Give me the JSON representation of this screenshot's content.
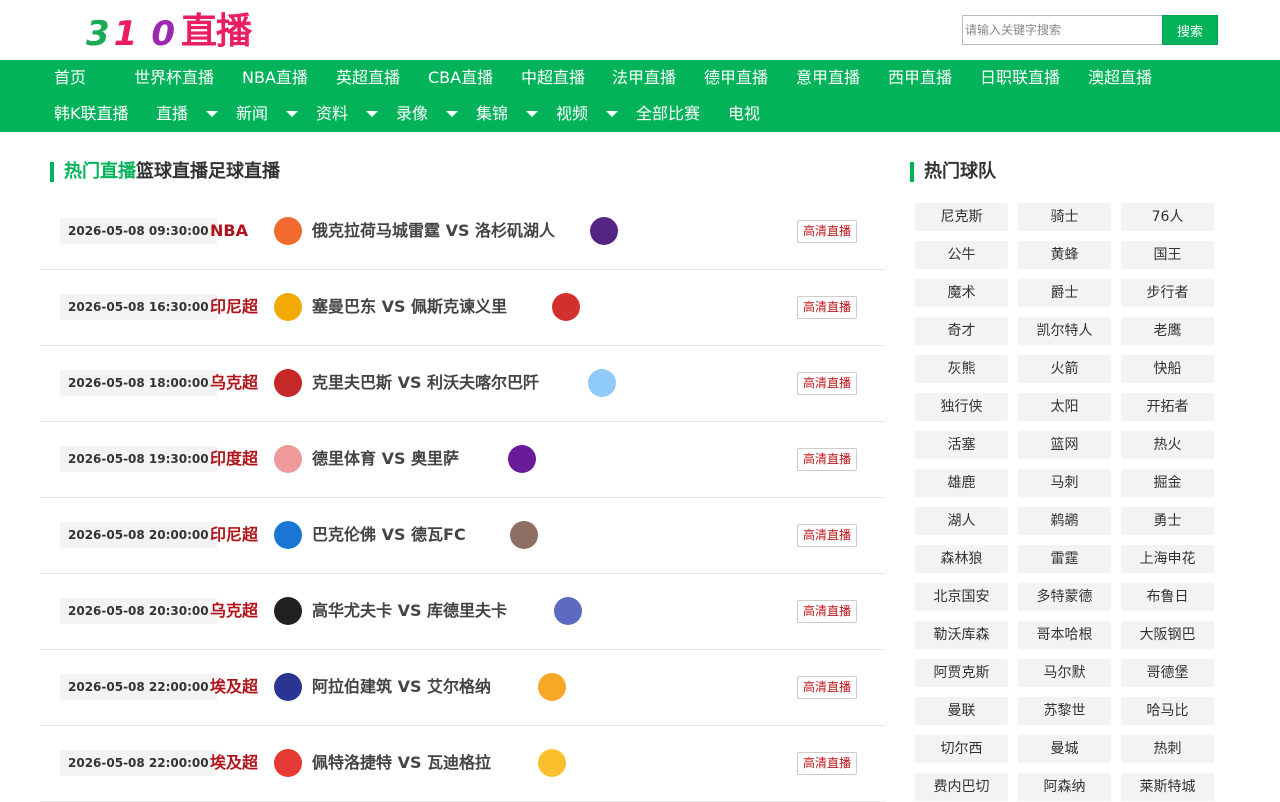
{
  "logo": {
    "d1": "3",
    "d2": "1",
    "d3": "0",
    "zh": "直播"
  },
  "search": {
    "placeholder": "请输入关键字搜索",
    "button": "搜索"
  },
  "nav": {
    "row1": [
      "首页",
      "世界杯直播",
      "NBA直播",
      "英超直播",
      "CBA直播",
      "中超直播",
      "法甲直播",
      "德甲直播",
      "意甲直播",
      "西甲直播",
      "日职联直播",
      "澳超直播"
    ],
    "row2": [
      "韩K联直播",
      "直播",
      "新闻",
      "资料",
      "录像",
      "集锦",
      "视频",
      "全部比赛",
      "电视"
    ]
  },
  "section": {
    "tabs": [
      "热门直播",
      "篮球直播",
      "足球直播"
    ]
  },
  "hd_label": "高清直播",
  "matches": [
    {
      "time": "2026-05-08 09:30:00",
      "league": "NBA",
      "teams": "俄克拉荷马城雷霆 VS 洛杉矶湖人",
      "color_a": "#f26a2e",
      "color_b": "#552583"
    },
    {
      "time": "2026-05-08 16:30:00",
      "league": "印尼超",
      "teams": "塞曼巴东 VS 佩斯克谏义里",
      "color_a": "#f2a900",
      "color_b": "#d32f2f"
    },
    {
      "time": "2026-05-08 18:00:00",
      "league": "乌克超",
      "teams": "克里夫巴斯 VS 利沃夫喀尔巴阡",
      "color_a": "#c62828",
      "color_b": "#90caf9"
    },
    {
      "time": "2026-05-08 19:30:00",
      "league": "印度超",
      "teams": "德里体育 VS 奥里萨",
      "color_a": "#ef9a9a",
      "color_b": "#6a1b9a"
    },
    {
      "time": "2026-05-08 20:00:00",
      "league": "印尼超",
      "teams": "巴克伦佛 VS 德瓦FC",
      "color_a": "#1976d2",
      "color_b": "#8d6e63"
    },
    {
      "time": "2026-05-08 20:30:00",
      "league": "乌克超",
      "teams": "高华尤夫卡 VS 库德里夫卡",
      "color_a": "#212121",
      "color_b": "#5c6bc0"
    },
    {
      "time": "2026-05-08 22:00:00",
      "league": "埃及超",
      "teams": "阿拉伯建筑 VS 艾尔格纳",
      "color_a": "#283593",
      "color_b": "#f9a825"
    },
    {
      "time": "2026-05-08 22:00:00",
      "league": "埃及超",
      "teams": "佩特洛捷特 VS 瓦迪格拉",
      "color_a": "#e53935",
      "color_b": "#fbc02d"
    }
  ],
  "sidebar": {
    "title": "热门球队",
    "teams": [
      "尼克斯",
      "骑士",
      "76人",
      "公牛",
      "黄蜂",
      "国王",
      "魔术",
      "爵士",
      "步行者",
      "奇才",
      "凯尔特人",
      "老鹰",
      "灰熊",
      "火箭",
      "快船",
      "独行侠",
      "太阳",
      "开拓者",
      "活塞",
      "篮网",
      "热火",
      "雄鹿",
      "马刺",
      "掘金",
      "湖人",
      "鹈鹕",
      "勇士",
      "森林狼",
      "雷霆",
      "上海申花",
      "北京国安",
      "多特蒙德",
      "布鲁日",
      "勒沃库森",
      "哥本哈根",
      "大阪钢巴",
      "阿贾克斯",
      "马尔默",
      "哥德堡",
      "曼联",
      "苏黎世",
      "哈马比",
      "切尔西",
      "曼城",
      "热刺",
      "费内巴切",
      "阿森纳",
      "莱斯特城"
    ]
  }
}
